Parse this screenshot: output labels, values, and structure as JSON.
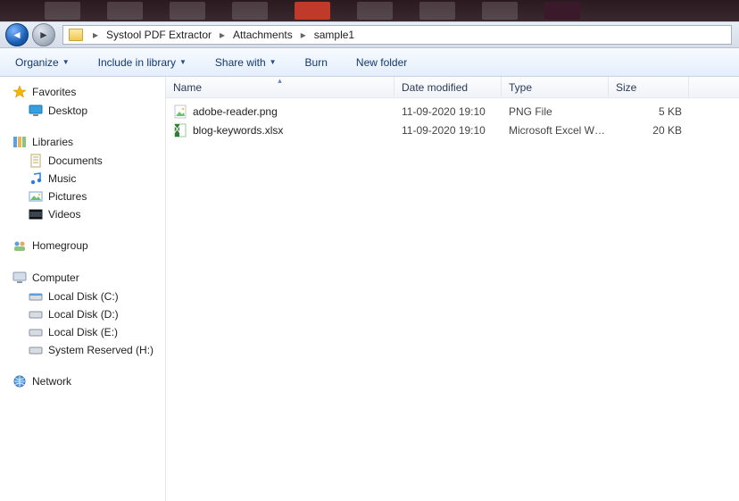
{
  "breadcrumbs": [
    "Systool PDF Extractor",
    "Attachments",
    "sample1"
  ],
  "toolbar": {
    "organize": "Organize",
    "include": "Include in library",
    "share": "Share with",
    "burn": "Burn",
    "newfolder": "New folder"
  },
  "columns": {
    "name": "Name",
    "date": "Date modified",
    "type": "Type",
    "size": "Size"
  },
  "sidebar": {
    "favorites": {
      "label": "Favorites",
      "items": [
        {
          "label": "Desktop",
          "icon": "desktop"
        }
      ]
    },
    "libraries": {
      "label": "Libraries",
      "items": [
        {
          "label": "Documents",
          "icon": "doc"
        },
        {
          "label": "Music",
          "icon": "music"
        },
        {
          "label": "Pictures",
          "icon": "pic"
        },
        {
          "label": "Videos",
          "icon": "vid"
        }
      ]
    },
    "homegroup": {
      "label": "Homegroup"
    },
    "computer": {
      "label": "Computer",
      "items": [
        {
          "label": "Local Disk (C:)",
          "icon": "diskc"
        },
        {
          "label": "Local Disk (D:)",
          "icon": "disk"
        },
        {
          "label": "Local Disk (E:)",
          "icon": "disk"
        },
        {
          "label": "System Reserved (H:)",
          "icon": "disk"
        }
      ]
    },
    "network": {
      "label": "Network"
    }
  },
  "files": [
    {
      "name": "adobe-reader.png",
      "date": "11-09-2020 19:10",
      "type": "PNG File",
      "size": "5 KB",
      "icon": "png"
    },
    {
      "name": "blog-keywords.xlsx",
      "date": "11-09-2020 19:10",
      "type": "Microsoft Excel W…",
      "size": "20 KB",
      "icon": "xlsx"
    }
  ]
}
